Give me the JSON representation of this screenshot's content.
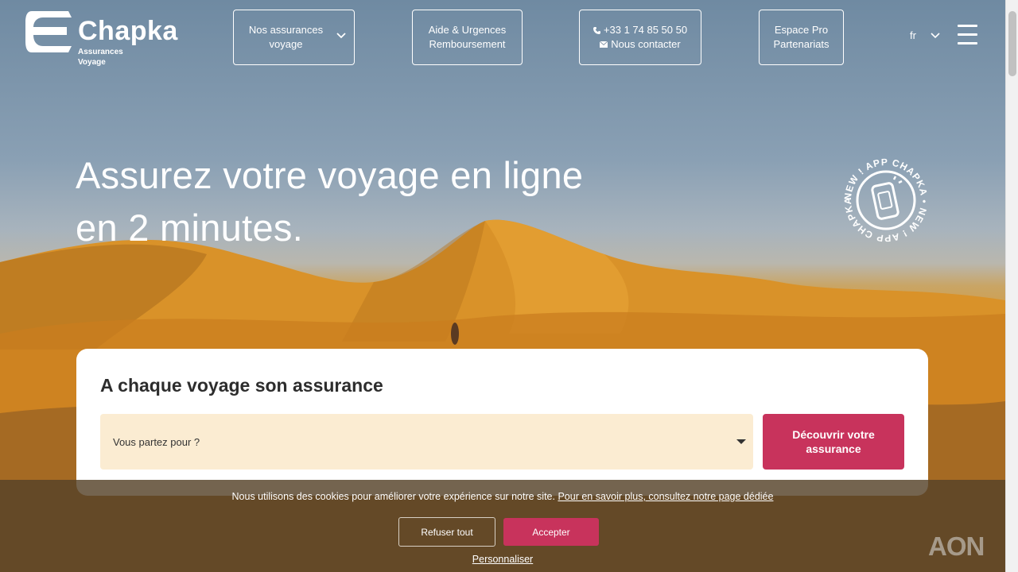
{
  "header": {
    "logo": {
      "name": "Chapka",
      "subtitle_line1": "Assurances",
      "subtitle_line2": "Voyage"
    },
    "nav": {
      "insurance": {
        "line1": "Nos assurances",
        "line2": "voyage"
      },
      "help": {
        "line1": "Aide & Urgences",
        "line2": "Remboursement"
      },
      "contact": {
        "phone": "+33 1 74 85 50 50",
        "label": "Nous contacter"
      },
      "pro": {
        "line1": "Espace Pro",
        "line2": "Partenariats"
      }
    },
    "language": "fr"
  },
  "hero": {
    "headline_line1": "Assurez votre voyage en ligne",
    "headline_line2": "en 2 minutes.",
    "badge_text": "NEW ! APP CHAPKA • NEW ! APP CHAPKA •"
  },
  "search": {
    "title": "A chaque voyage son assurance",
    "destination_placeholder": "Vous partez pour ?",
    "submit_label": "Découvrir votre assurance"
  },
  "cookie": {
    "message": "Nous utilisons des cookies pour améliorer votre expérience sur notre site.",
    "link": "Pour en savoir plus, consultez notre page dédiée",
    "refuse": "Refuser tout",
    "accept": "Accepter",
    "customize": "Personnaliser"
  },
  "footer_logo": "AON",
  "colors": {
    "accent": "#c8335c",
    "select_bg": "#fbecd2",
    "text_dark": "#2d2d2d"
  }
}
